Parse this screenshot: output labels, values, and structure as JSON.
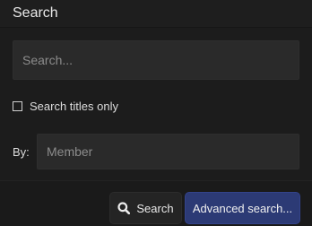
{
  "header": {
    "title": "Search"
  },
  "search": {
    "placeholder": "Search..."
  },
  "options": {
    "titles_only_label": "Search titles only",
    "titles_only_checked": false
  },
  "by": {
    "label": "By:",
    "placeholder": "Member"
  },
  "actions": {
    "search_label": "Search",
    "search_icon": "magnifier-icon",
    "advanced_label": "Advanced search..."
  },
  "colors": {
    "background": "#1c1c1c",
    "input_bg": "#2a2a2a",
    "advanced_button_bg": "#2c3a75"
  }
}
